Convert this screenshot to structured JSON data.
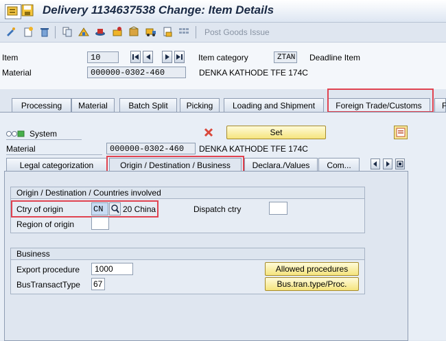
{
  "window": {
    "title": "Delivery 1134637538 Change: Item Details"
  },
  "toolbar": {
    "icons": [
      "edit-icon",
      "new-item-icon",
      "delete-icon",
      "copy-icon",
      "hierarchy-icon",
      "hat-icon",
      "tools-icon",
      "package-icon",
      "vehicle-icon",
      "doc-icon",
      "grid-icon"
    ],
    "post_goods_issue": "Post Goods Issue"
  },
  "header": {
    "item_label": "Item",
    "item_value": "10",
    "item_category_label": "Item category",
    "item_category_value": "ZTAN",
    "item_category_text": "Deadline Item",
    "material_label": "Material",
    "material_value": "000000-0302-460",
    "material_text": "DENKA KATHODE TFE 174C"
  },
  "main_tabs": [
    {
      "label": "Processing"
    },
    {
      "label": "Material"
    },
    {
      "label": "Batch Split"
    },
    {
      "label": "Picking"
    },
    {
      "label": "Loading and Shipment"
    },
    {
      "label": "Foreign Trade/Customs"
    },
    {
      "label": "F"
    }
  ],
  "foreign_trade": {
    "system_label": "System",
    "set_button": "Set",
    "material_label": "Material",
    "material_value": "000000-0302-460",
    "material_text": "DENKA KATHODE TFE 174C",
    "sub_tabs": [
      {
        "label": "Legal categorization"
      },
      {
        "label": "Origin / Destination / Business"
      },
      {
        "label": "Declara./Values"
      },
      {
        "label": "Com..."
      }
    ],
    "origin_group": {
      "title": "Origin / Destination / Countries involved",
      "ctry_of_origin_label": "Ctry of origin",
      "ctry_of_origin_value": "CN",
      "ctry_of_origin_text": "20 China",
      "dispatch_ctry_label": "Dispatch ctry",
      "dispatch_ctry_value": "",
      "region_of_origin_label": "Region of origin",
      "region_of_origin_value": ""
    },
    "business_group": {
      "title": "Business",
      "export_procedure_label": "Export procedure",
      "export_procedure_value": "1000",
      "bus_transact_type_label": "BusTransactType",
      "bus_transact_type_value": "67",
      "allowed_procedures_button": "Allowed procedures",
      "bus_tran_type_button": "Bus.tran.type/Proc."
    }
  }
}
